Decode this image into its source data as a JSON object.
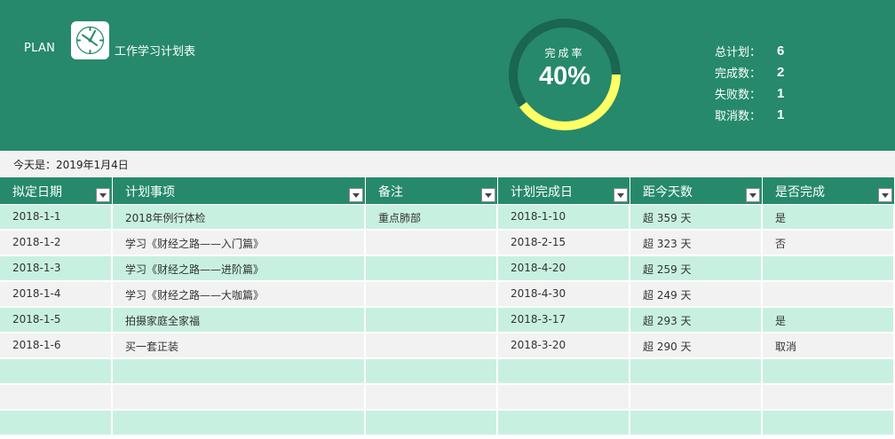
{
  "header": {
    "plan_label": "PLAN",
    "title": "工作学习计划表",
    "icon": "clock-icon",
    "accent_color": "#26896b"
  },
  "completion": {
    "label": "完成率",
    "value_text": "40%",
    "fraction": 0.4,
    "ring_color": "#ffff66"
  },
  "stats": [
    {
      "label": "总计划：",
      "value": "6"
    },
    {
      "label": "完成数：",
      "value": "2"
    },
    {
      "label": "失败数：",
      "value": "1"
    },
    {
      "label": "取消数：",
      "value": "1"
    }
  ],
  "today": "今天是：2019年1月4日",
  "table": {
    "columns": [
      "拟定日期",
      "计划事项",
      "备注",
      "计划完成日",
      "距今天数",
      "是否完成"
    ],
    "rows": [
      [
        "2018-1-1",
        "2018年例行体检",
        "重点肺部",
        "2018-1-10",
        "超 359 天",
        "是"
      ],
      [
        "2018-1-2",
        "学习《财经之路——入门篇》",
        "",
        "2018-2-15",
        "超 323 天",
        "否"
      ],
      [
        "2018-1-3",
        "学习《财经之路——进阶篇》",
        "",
        "2018-4-20",
        "超 259 天",
        ""
      ],
      [
        "2018-1-4",
        "学习《财经之路——大咖篇》",
        "",
        "2018-4-30",
        "超 249 天",
        ""
      ],
      [
        "2018-1-5",
        "拍摄家庭全家福",
        "",
        "2018-3-17",
        "超 293 天",
        "是"
      ],
      [
        "2018-1-6",
        "买一套正装",
        "",
        "2018-3-20",
        "超 290 天",
        "取消"
      ],
      [
        "",
        "",
        "",
        "",
        "",
        ""
      ],
      [
        "",
        "",
        "",
        "",
        "",
        ""
      ],
      [
        "",
        "",
        "",
        "",
        "",
        ""
      ]
    ]
  }
}
